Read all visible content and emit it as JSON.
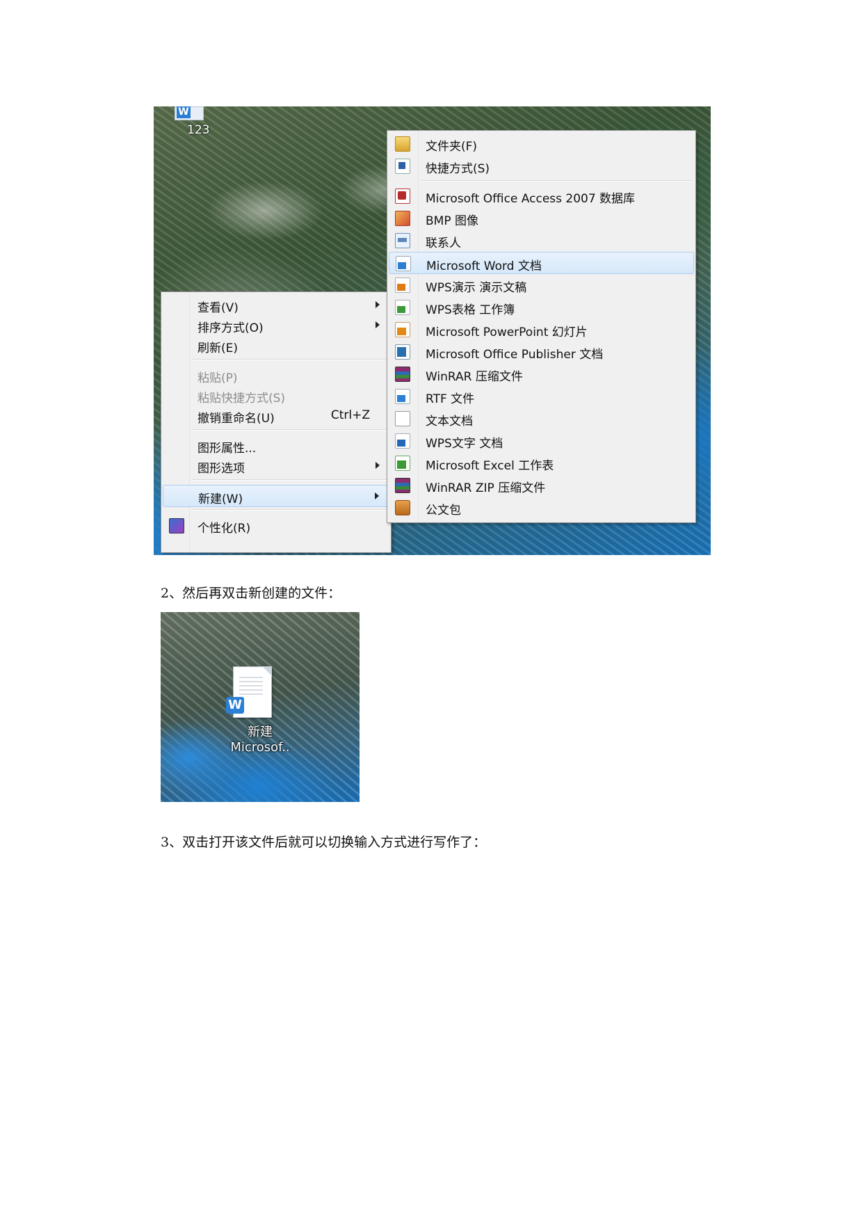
{
  "screenshot1": {
    "desktop_icon_label": "123",
    "context_menu": {
      "items": [
        {
          "label": "查看(V)",
          "submenu": true
        },
        {
          "label": "排序方式(O)",
          "submenu": true
        },
        {
          "label": "刷新(E)"
        },
        {
          "label": "粘贴(P)",
          "disabled": true
        },
        {
          "label": "粘贴快捷方式(S)",
          "disabled": true
        },
        {
          "label": "撤销重命名(U)",
          "shortcut": "Ctrl+Z"
        },
        {
          "label": "图形属性..."
        },
        {
          "label": "图形选项",
          "submenu": true
        },
        {
          "label": "新建(W)",
          "submenu": true,
          "highlighted": true
        },
        {
          "label": "个性化(R)"
        }
      ]
    },
    "new_submenu": {
      "items": [
        {
          "label": "文件夹(F)",
          "icon": "folder-icon"
        },
        {
          "label": "快捷方式(S)",
          "icon": "shortcut-icon"
        },
        {
          "label": "Microsoft Office Access 2007 数据库",
          "icon": "access-database-icon"
        },
        {
          "label": "BMP 图像",
          "icon": "bmp-image-icon"
        },
        {
          "label": "联系人",
          "icon": "contact-card-icon"
        },
        {
          "label": "Microsoft Word 文档",
          "icon": "word-document-icon",
          "highlighted": true
        },
        {
          "label": "WPS演示 演示文稿",
          "icon": "wps-presentation-icon"
        },
        {
          "label": "WPS表格 工作簿",
          "icon": "wps-spreadsheet-icon"
        },
        {
          "label": "Microsoft PowerPoint 幻灯片",
          "icon": "powerpoint-icon"
        },
        {
          "label": "Microsoft Office Publisher 文档",
          "icon": "publisher-icon"
        },
        {
          "label": "WinRAR 压缩文件",
          "icon": "winrar-archive-icon"
        },
        {
          "label": "RTF 文件",
          "icon": "rtf-file-icon"
        },
        {
          "label": "文本文档",
          "icon": "text-document-icon"
        },
        {
          "label": "WPS文字 文档",
          "icon": "wps-writer-icon"
        },
        {
          "label": "Microsoft Excel 工作表",
          "icon": "excel-worksheet-icon"
        },
        {
          "label": "WinRAR ZIP 压缩文件",
          "icon": "winrar-zip-icon"
        },
        {
          "label": "公文包",
          "icon": "briefcase-icon"
        }
      ]
    }
  },
  "captions": {
    "step2": "2、然后再双击新创建的文件：",
    "step3": "3、双击打开该文件后就可以切换输入方式进行写作了："
  },
  "screenshot2": {
    "file_label_line1": "新建",
    "file_label_line2": "Microsof..",
    "file_badge": "W"
  }
}
